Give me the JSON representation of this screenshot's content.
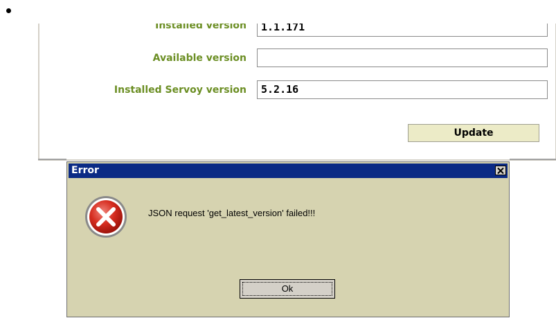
{
  "settings": {
    "rows": [
      {
        "label": "Installed version",
        "value": "1.1.171"
      },
      {
        "label": "Available version",
        "value": ""
      },
      {
        "label": "Installed Servoy version",
        "value": "5.2.16"
      }
    ],
    "update_label": "Update"
  },
  "dialog": {
    "title": "Error",
    "close_glyph": "✕",
    "message": "JSON request 'get_latest_version' failed!!!",
    "ok_label": "Ok",
    "icon": "error-icon"
  },
  "colors": {
    "label_green": "#6b8e23",
    "dialog_bg": "#d6d3b0",
    "titlebar": "#0b2a85",
    "update_bg": "#ecebc7",
    "error_red": "#d62d20"
  }
}
